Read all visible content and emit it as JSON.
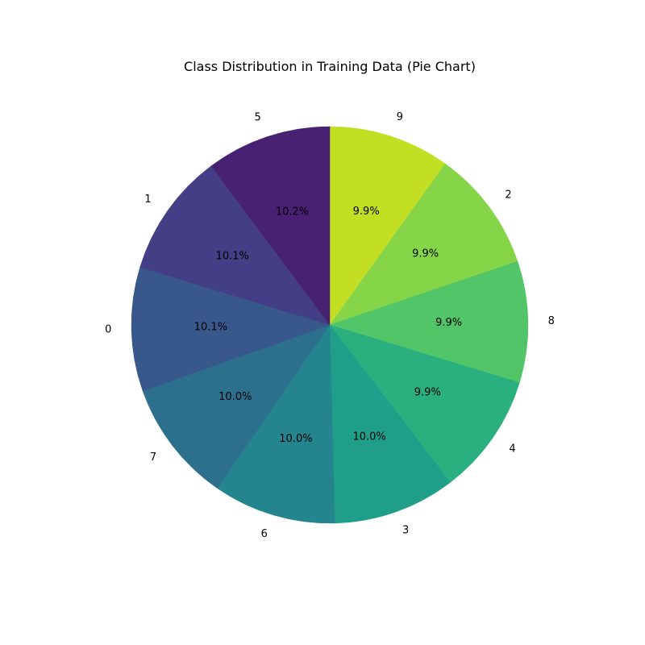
{
  "chart_data": {
    "type": "pie",
    "title": "Class Distribution in Training Data (Pie Chart)",
    "start_angle_deg": 90,
    "direction": "clockwise",
    "slices": [
      {
        "label": "9",
        "value": 9.9,
        "pct_label": "9.9%",
        "color": "#c2df23"
      },
      {
        "label": "2",
        "value": 9.9,
        "pct_label": "9.9%",
        "color": "#86d549"
      },
      {
        "label": "8",
        "value": 9.9,
        "pct_label": "9.9%",
        "color": "#52c569"
      },
      {
        "label": "4",
        "value": 9.9,
        "pct_label": "9.9%",
        "color": "#2ab07f"
      },
      {
        "label": "3",
        "value": 10.0,
        "pct_label": "10.0%",
        "color": "#1f9e89"
      },
      {
        "label": "6",
        "value": 10.0,
        "pct_label": "10.0%",
        "color": "#25858e"
      },
      {
        "label": "7",
        "value": 10.0,
        "pct_label": "10.0%",
        "color": "#2d708e"
      },
      {
        "label": "0",
        "value": 10.1,
        "pct_label": "10.1%",
        "color": "#38588c"
      },
      {
        "label": "1",
        "value": 10.1,
        "pct_label": "10.1%",
        "color": "#433e85"
      },
      {
        "label": "5",
        "value": 10.2,
        "pct_label": "10.2%",
        "color": "#482173"
      }
    ]
  }
}
